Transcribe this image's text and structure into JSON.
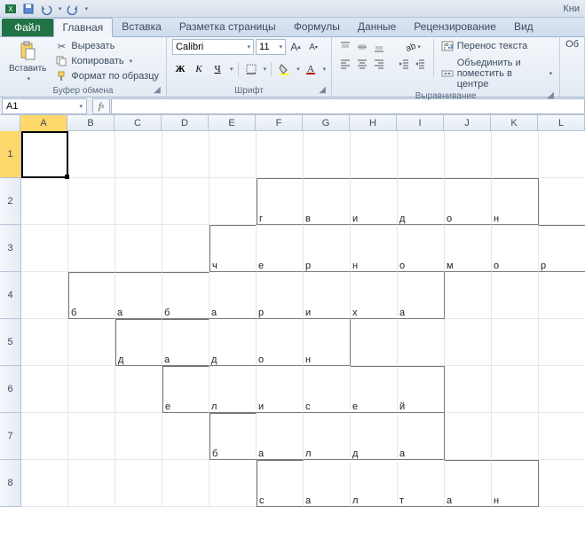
{
  "title": "Кни",
  "file_tab": "Файл",
  "tabs": [
    "Главная",
    "Вставка",
    "Разметка страницы",
    "Формулы",
    "Данные",
    "Рецензирование",
    "Вид"
  ],
  "active_tab": 0,
  "clipboard": {
    "paste": "Вставить",
    "cut": "Вырезать",
    "copy": "Копировать",
    "painter": "Формат по образцу",
    "group": "Буфер обмена"
  },
  "font": {
    "name": "Calibri",
    "size": "11",
    "group": "Шрифт",
    "bold": "Ж",
    "italic": "К",
    "underline": "Ч"
  },
  "alignment": {
    "wrap": "Перенос текста",
    "merge": "Объединить и поместить в центре",
    "group": "Выравнивание"
  },
  "general_trunc": "Об",
  "namebox": "A1",
  "columns": [
    "A",
    "B",
    "C",
    "D",
    "E",
    "F",
    "G",
    "H",
    "I",
    "J",
    "K",
    "L"
  ],
  "rows": [
    "1",
    "2",
    "3",
    "4",
    "5",
    "6",
    "7",
    "8"
  ],
  "selected_col": 0,
  "selected_row": 0,
  "cell_values": {
    "2": {
      "F": "г",
      "G": "в",
      "H": "и",
      "I": "д",
      "J": "о",
      "K": "н"
    },
    "3": {
      "E": "ч",
      "F": "е",
      "G": "р",
      "H": "н",
      "I": "о",
      "J": "м",
      "K": "о",
      "L": "р"
    },
    "4": {
      "B": "б",
      "C": "а",
      "D": "б",
      "E": "а",
      "F": "р",
      "G": "и",
      "H": "х",
      "I": "а"
    },
    "5": {
      "C": "д",
      "D": "а",
      "E": "д",
      "F": "о",
      "G": "н"
    },
    "6": {
      "D": "е",
      "E": "л",
      "F": "и",
      "G": "с",
      "H": "е",
      "I": "й"
    },
    "7": {
      "E": "б",
      "F": "а",
      "G": "л",
      "H": "д",
      "I": "а"
    },
    "8": {
      "F": "с",
      "G": "а",
      "H": "л",
      "I": "т",
      "J": "а",
      "K": "н"
    }
  },
  "borders": {
    "2": {
      "F": "tlb",
      "G": "tb",
      "H": "tb",
      "I": "tb",
      "J": "tb",
      "K": "trb"
    },
    "3": {
      "E": "tlb",
      "F": "b",
      "G": "b",
      "H": "b",
      "I": "b",
      "J": "b",
      "K": "b",
      "L": "trb"
    },
    "4": {
      "B": "tlb",
      "C": "tb",
      "D": "tb",
      "E": "b",
      "F": "b",
      "G": "b",
      "H": "b",
      "I": "rb"
    },
    "5": {
      "C": "tlb",
      "D": "tb",
      "E": "b",
      "F": "b",
      "G": "rb"
    },
    "6": {
      "D": "tlb",
      "E": "b",
      "F": "b",
      "G": "b",
      "H": "tb",
      "I": "trb"
    },
    "7": {
      "E": "tlb",
      "F": "b",
      "G": "b",
      "H": "b",
      "I": "rb"
    },
    "8": {
      "F": "tlb",
      "G": "b",
      "H": "b",
      "I": "b",
      "J": "tb",
      "K": "trb"
    }
  }
}
